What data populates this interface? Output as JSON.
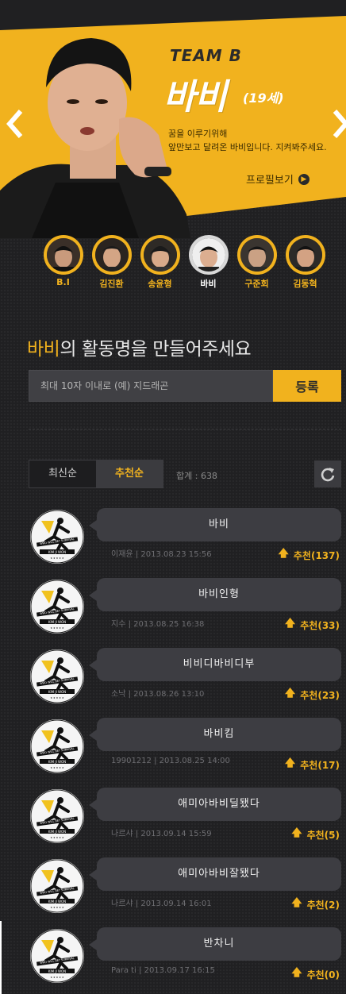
{
  "hero": {
    "team": "TEAM B",
    "name": "바비",
    "age": "(19세)",
    "tagline_line1": "꿈을 이루기위해",
    "tagline_line2": "앞만보고 달려온 바비입니다. 지켜봐주세요.",
    "profile_link": "프로필보기",
    "colors": {
      "accent": "#f1b21e",
      "background": "#202022"
    }
  },
  "members": [
    {
      "label": "B.I",
      "active": false
    },
    {
      "label": "김진환",
      "active": false
    },
    {
      "label": "송윤형",
      "active": false
    },
    {
      "label": "바비",
      "active": true
    },
    {
      "label": "구준회",
      "active": false
    },
    {
      "label": "김동혁",
      "active": false
    }
  ],
  "naming": {
    "prompt_highlight": "바비",
    "prompt_rest": "의 활동명을 만들어주세요",
    "input_placeholder": "최대 10자 이내로 (예) 지드래곤",
    "submit_label": "등록"
  },
  "sort": {
    "tab_latest": "최신순",
    "tab_recommended": "추천순",
    "active": "추천순",
    "total_label": "합계 : 638"
  },
  "suggestions": [
    {
      "name": "바비",
      "author": "이재윤",
      "date": "2013.08.23 15:56",
      "recommend": "추천(137)"
    },
    {
      "name": "바비인형",
      "author": "지수",
      "date": "2013.08.25 16:38",
      "recommend": "추천(33)"
    },
    {
      "name": "비비디바비디부",
      "author": "소낙",
      "date": "2013.08.26 13:10",
      "recommend": "추천(23)"
    },
    {
      "name": "바비킴",
      "author": "19901212",
      "date": "2013.08.25 14:00",
      "recommend": "추천(17)"
    },
    {
      "name": "애미아바비딜됐다",
      "author": "나르샤",
      "date": "2013.09.14 15:59",
      "recommend": "추천(5)"
    },
    {
      "name": "애미아바비잘됐다",
      "author": "나르샤",
      "date": "2013.09.14 16:01",
      "recommend": "추천(2)"
    },
    {
      "name": "반차니",
      "author": "Para ti",
      "date": "2013.09.17 16:15",
      "recommend": "추천(0)"
    }
  ],
  "avatar_badge": {
    "line1": "WHO WILL BE? SURVIVAL",
    "line2": "KIM JI WON"
  }
}
